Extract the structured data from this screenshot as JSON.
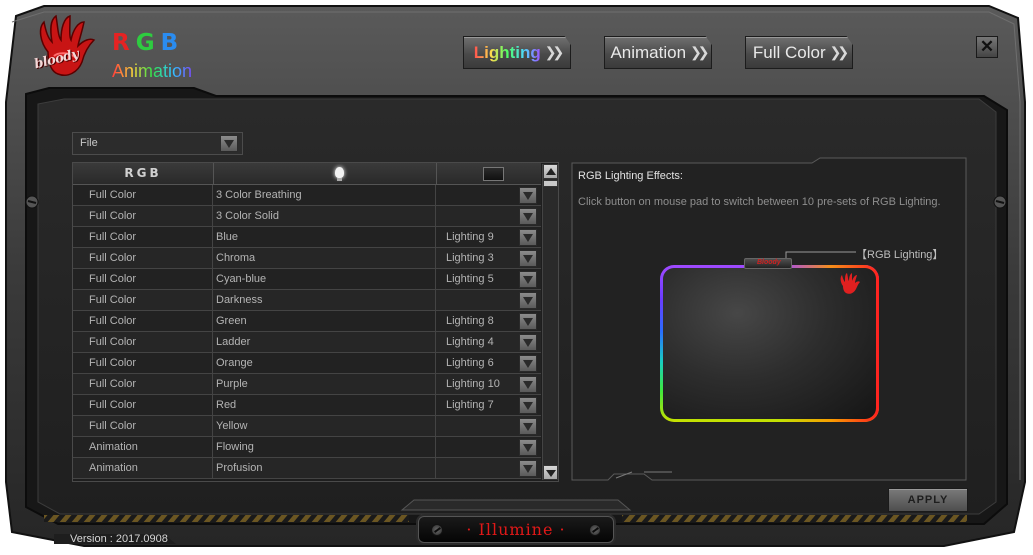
{
  "brand": {
    "logo_text": "bloody",
    "title_r": "R",
    "title_g": "G",
    "title_b": "B",
    "subtitle": "Animation"
  },
  "tabs": [
    {
      "label": "Lighting",
      "active": true
    },
    {
      "label": "Animation",
      "active": false
    },
    {
      "label": "Full Color",
      "active": false
    }
  ],
  "close_label": "✕",
  "file_select": {
    "value": "File"
  },
  "table": {
    "header_rgb": "RGB",
    "rows": [
      {
        "type": "Full Color",
        "effect": "3 Color Breathing",
        "preset": ""
      },
      {
        "type": "Full Color",
        "effect": "3 Color Solid",
        "preset": ""
      },
      {
        "type": "Full Color",
        "effect": "Blue",
        "preset": "Lighting 9"
      },
      {
        "type": "Full Color",
        "effect": "Chroma",
        "preset": "Lighting 3"
      },
      {
        "type": "Full Color",
        "effect": "Cyan-blue",
        "preset": "Lighting 5"
      },
      {
        "type": "Full Color",
        "effect": "Darkness",
        "preset": ""
      },
      {
        "type": "Full Color",
        "effect": "Green",
        "preset": "Lighting 8"
      },
      {
        "type": "Full Color",
        "effect": "Ladder",
        "preset": "Lighting 4"
      },
      {
        "type": "Full Color",
        "effect": "Orange",
        "preset": "Lighting 6"
      },
      {
        "type": "Full Color",
        "effect": "Purple",
        "preset": "Lighting 10"
      },
      {
        "type": "Full Color",
        "effect": "Red",
        "preset": "Lighting 7"
      },
      {
        "type": "Full Color",
        "effect": "Yellow",
        "preset": ""
      },
      {
        "type": "Animation",
        "effect": "Flowing",
        "preset": ""
      },
      {
        "type": "Animation",
        "effect": "Profusion",
        "preset": ""
      }
    ]
  },
  "effects_panel": {
    "title": "RGB Lighting Effects:",
    "description": "Click button on mouse pad to switch between 10 pre-sets of RGB Lighting.",
    "callout_label": "【RGB Lighting】",
    "pad_tab_text": "Bloody"
  },
  "apply_label": "APPLY",
  "footer": {
    "illumine": "· Illumine ·",
    "version": "Version : 2017.0908"
  },
  "colors": {
    "accent_red": "#e01818",
    "frame_dark": "#1b1b1b",
    "panel": "#262626"
  }
}
